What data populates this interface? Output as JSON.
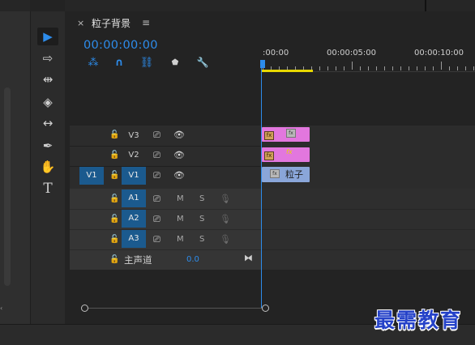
{
  "panel": {
    "close_glyph": "×",
    "title": "粒子背景",
    "menu_glyph": "≡",
    "timecode": "00:00:00:00"
  },
  "header_icons": [
    {
      "icon": "nest-sequence-icon",
      "glyph": "⁂"
    },
    {
      "icon": "snap-magnet-icon",
      "glyph": "∩"
    },
    {
      "icon": "linked-selection-icon",
      "glyph": "⛓"
    },
    {
      "icon": "add-marker-icon",
      "glyph": "⬟"
    },
    {
      "icon": "wrench-settings-icon",
      "glyph": "🔧"
    }
  ],
  "tools": [
    {
      "icon": "selection-tool-icon",
      "glyph": "▶",
      "selected": true
    },
    {
      "icon": "track-select-tool-icon",
      "glyph": "⇨"
    },
    {
      "icon": "ripple-edit-tool-icon",
      "glyph": "⇹"
    },
    {
      "icon": "razor-tool-icon",
      "glyph": "◈"
    },
    {
      "icon": "slip-tool-icon",
      "glyph": "↔"
    },
    {
      "icon": "pen-tool-icon",
      "glyph": "✒"
    },
    {
      "icon": "hand-tool-icon",
      "glyph": "✋"
    },
    {
      "icon": "type-tool-icon",
      "glyph": "T"
    }
  ],
  "ruler": {
    "labels": [
      ":00:00",
      "00:00:05:00",
      "00:00:10:00"
    ]
  },
  "video_tracks": [
    {
      "name": "V3",
      "lock": "🔓",
      "camera": "⎚",
      "eye": "👁"
    },
    {
      "name": "V2",
      "lock": "🔓",
      "camera": "⎚",
      "eye": "👁"
    },
    {
      "name": "V1",
      "lock": "🔓",
      "camera": "⎚",
      "eye": "👁",
      "source": "V1"
    }
  ],
  "audio_tracks": [
    {
      "name": "A1",
      "lock": "🔓",
      "camera": "⎚",
      "mute": "M",
      "solo": "S",
      "mic": "🎙"
    },
    {
      "name": "A2",
      "lock": "🔓",
      "camera": "⎚",
      "mute": "M",
      "solo": "S",
      "mic": "🎙"
    },
    {
      "name": "A3",
      "lock": "🔓",
      "camera": "⎚",
      "mute": "M",
      "solo": "S",
      "mic": "🎙"
    }
  ],
  "master": {
    "lock": "🔓",
    "label": "主声道",
    "value": "0.0",
    "end_glyph": "⧓"
  },
  "clips": [
    {
      "track": "V3",
      "effect_badge": "fx",
      "label": ""
    },
    {
      "track": "V2",
      "effect_badge": "fx",
      "label": ""
    },
    {
      "track": "V1",
      "effect_badge": "fx",
      "label": "粒子"
    }
  ],
  "watermark": "最需教育",
  "colors": {
    "accent": "#2d8ceb",
    "clip_pink": "#e277de",
    "clip_blue": "#8aa6d9",
    "work_area": "#e8d800"
  }
}
